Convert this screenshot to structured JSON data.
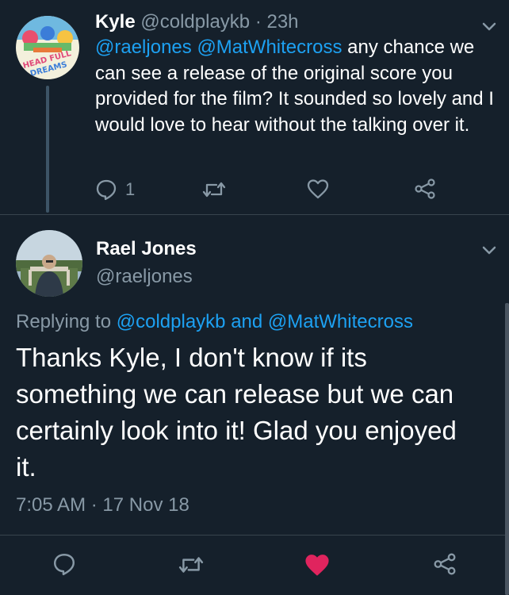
{
  "parent_tweet": {
    "display_name": "Kyle",
    "handle": "@coldplaykb",
    "separator": "·",
    "time_ago": "23h",
    "mentions": [
      "@raeljones",
      "@MatWhitecross"
    ],
    "text_after_mentions": "any chance we can see a release of the original score you provided for the film? It sounded so lovely and I would love to hear without the talking over it.",
    "reply_count": "1",
    "avatar_text": "HEAD FULL OF DREAMS"
  },
  "main_tweet": {
    "display_name": "Rael Jones",
    "handle": "@raeljones",
    "replying_prefix": "Replying to",
    "replying_user_1": "@coldplaykb",
    "replying_and": "and",
    "replying_user_2": "@MatWhitecross",
    "text": "Thanks Kyle, I don't know if its something we can release but we can certainly look into it! Glad you enjoyed it.",
    "time": "7:05 AM",
    "separator": "·",
    "date": "17 Nov 18"
  },
  "icons": {
    "reply": "reply-icon",
    "retweet": "retweet-icon",
    "like": "heart-icon",
    "share": "share-icon",
    "menu": "chevron-down-icon"
  },
  "colors": {
    "background": "#15202b",
    "accent": "#1da1f2",
    "muted": "#8899a6",
    "liked": "#e0245e",
    "divider": "#38444d"
  }
}
